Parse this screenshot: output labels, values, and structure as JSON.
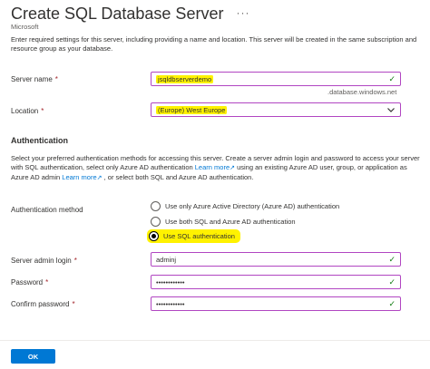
{
  "header": {
    "title": "Create SQL Database Server",
    "more": "···",
    "subtitle": "Microsoft",
    "intro": "Enter required settings for this server, including providing a name and location. This server will be created in the same subscription and resource group as your database."
  },
  "server_name": {
    "label": "Server name",
    "required": "*",
    "value": "jsqldbserverdemo",
    "suffix": ".database.windows.net"
  },
  "location": {
    "label": "Location",
    "required": "*",
    "value": "(Europe) West Europe"
  },
  "authentication": {
    "heading": "Authentication",
    "desc_1": "Select your preferred authentication methods for accessing this server. Create a server admin login and password to access your server with SQL authentication, select only Azure AD authentication ",
    "link_1": "Learn more",
    "desc_2": " using an existing Azure AD user, group, or application as Azure AD admin ",
    "link_2": "Learn more",
    "desc_3": " , or select both SQL and Azure AD authentication.",
    "method_label": "Authentication method",
    "options": [
      "Use only Azure Active Directory (Azure AD) authentication",
      "Use both SQL and Azure AD authentication",
      "Use SQL authentication"
    ],
    "selected_index": 2
  },
  "admin_login": {
    "label": "Server admin login",
    "required": "*",
    "value": "adminj"
  },
  "password": {
    "label": "Password",
    "required": "*",
    "value": "••••••••••••"
  },
  "confirm_password": {
    "label": "Confirm password",
    "required": "*",
    "value": "••••••••••••"
  },
  "footer": {
    "ok_label": "OK"
  },
  "colors": {
    "accent": "#0078d4",
    "focus_border": "#b146c2",
    "highlight": "#fff200",
    "valid": "#107c10",
    "required": "#a4262c"
  },
  "icons": {
    "valid": "checkmark-icon",
    "dropdown": "chevron-down-icon",
    "external": "external-link-icon"
  }
}
